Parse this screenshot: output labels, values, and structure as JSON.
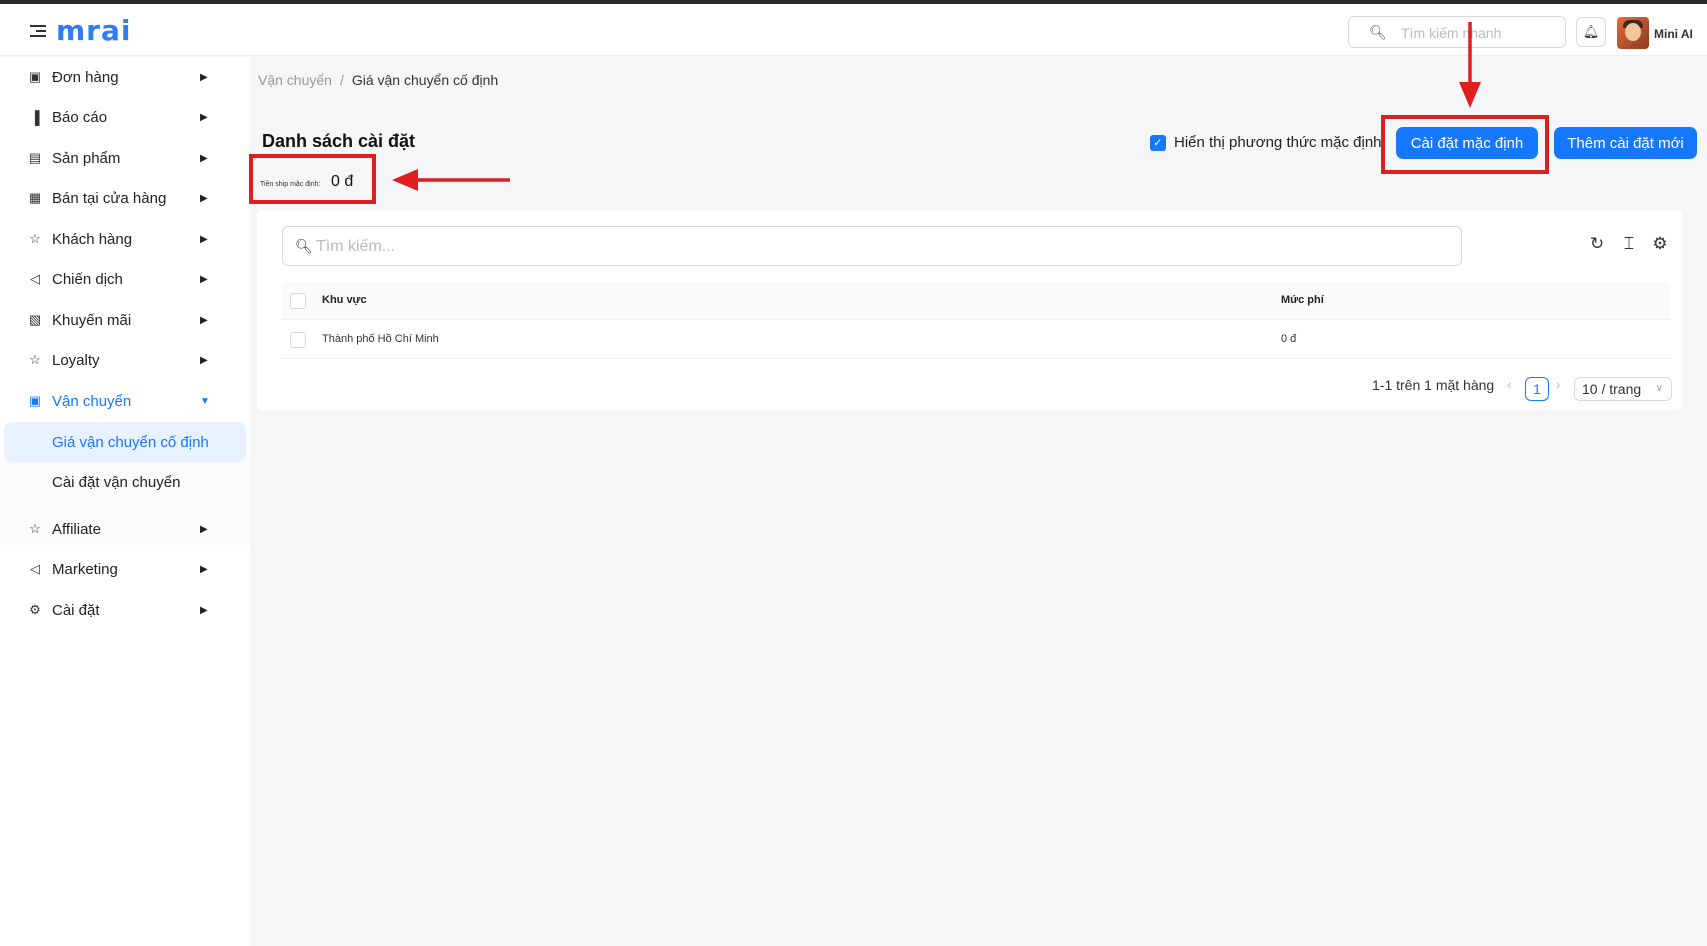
{
  "header": {
    "logo_text": "mrai",
    "search_placeholder": "Tìm kiếm nhanh",
    "username": "Mini AI"
  },
  "sidebar": {
    "items": [
      {
        "label": "Đơn hàng",
        "icon": "bag-icon"
      },
      {
        "label": "Báo cáo",
        "icon": "chart-icon"
      },
      {
        "label": "Sản phẩm",
        "icon": "box-icon"
      },
      {
        "label": "Bán tại cửa hàng",
        "icon": "store-icon"
      },
      {
        "label": "Khách hàng",
        "icon": "users-icon"
      },
      {
        "label": "Chiến dịch",
        "icon": "megaphone-icon"
      },
      {
        "label": "Khuyến mãi",
        "icon": "gift-icon"
      },
      {
        "label": "Loyalty",
        "icon": "star-icon"
      },
      {
        "label": "Vận chuyển",
        "icon": "truck-icon"
      },
      {
        "label": "Affiliate",
        "icon": "affiliate-icon"
      },
      {
        "label": "Marketing",
        "icon": "megaphone-icon"
      },
      {
        "label": "Cài đặt",
        "icon": "gear-icon"
      }
    ],
    "subitems": [
      {
        "label": "Giá vận chuyển cố định"
      },
      {
        "label": "Cài đặt vận chuyển"
      }
    ]
  },
  "breadcrumb": {
    "parent": "Vận chuyển",
    "separator": "/",
    "current": "Giá vận chuyển cố định"
  },
  "page": {
    "title": "Danh sách cài đặt",
    "ship_label": "Tiền ship mặc định:",
    "ship_value": "0 đ",
    "show_default_label": "Hiển thị phương thức mặc định",
    "default_button": "Cài đặt mặc định",
    "add_button": "Thêm cài đặt mới"
  },
  "table": {
    "search_placeholder": "Tìm kiếm...",
    "columns": [
      "Khu vực",
      "Mức phí"
    ],
    "rows": [
      {
        "region": "Thành phố Hồ Chí Minh",
        "fee": "0 đ"
      }
    ]
  },
  "pagination": {
    "summary": "1-1 trên 1 mặt hàng",
    "current_page": "1",
    "page_size": "10 / trang"
  },
  "colors": {
    "primary": "#1677ff",
    "annotation_red": "#e01e1e"
  }
}
